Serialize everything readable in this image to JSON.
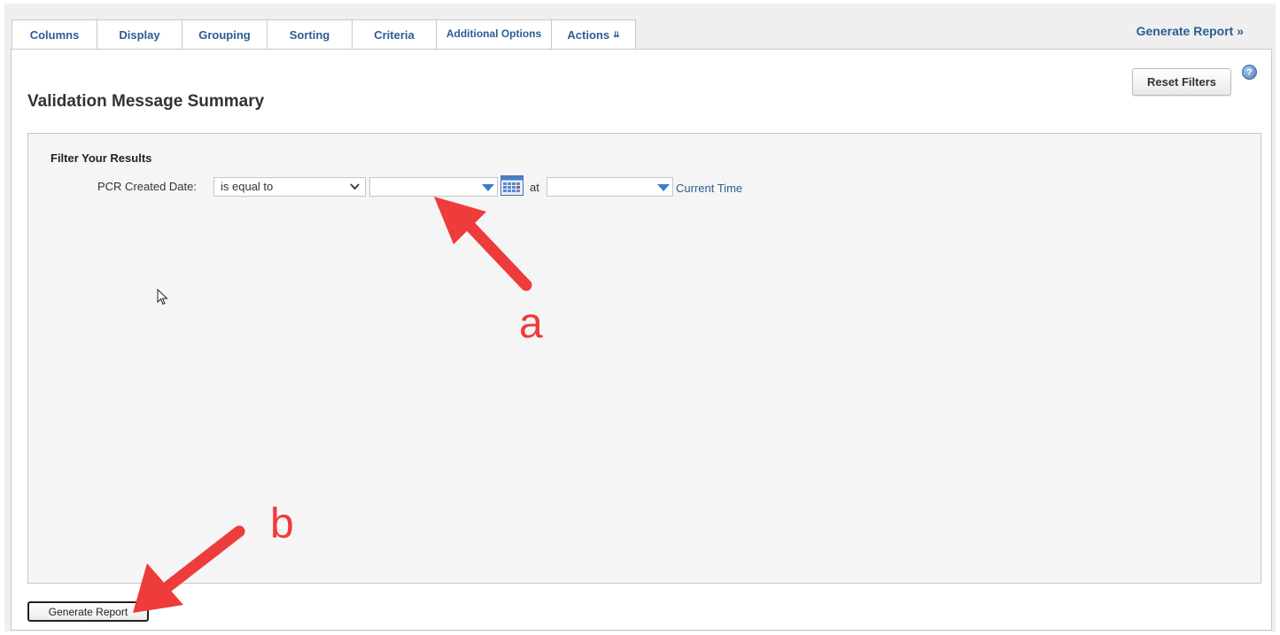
{
  "tabs": [
    {
      "label": "Columns"
    },
    {
      "label": "Display"
    },
    {
      "label": "Grouping"
    },
    {
      "label": "Sorting"
    },
    {
      "label": "Criteria"
    },
    {
      "label": "Additional Options"
    },
    {
      "label": "Actions",
      "suffix": "»"
    }
  ],
  "header": {
    "generate_link": "Generate Report »",
    "help_icon": "question-circle-icon"
  },
  "report": {
    "title": "Validation Message Summary",
    "reset_filters": "Reset Filters"
  },
  "filter": {
    "heading": "Filter Your Results",
    "field_label": "PCR Created Date:",
    "operator_value": "is equal to",
    "date_value": "",
    "at_label": "at",
    "time_value": "",
    "current_time_link": "Current Time",
    "calendar_icon": "calendar-icon"
  },
  "footer": {
    "generate_button": "Generate Report"
  },
  "annotations": {
    "label_a": "a",
    "label_b": "b",
    "arrow_color": "#ee3b3b"
  },
  "colors": {
    "link": "#2b5d94",
    "annotation": "#ee3b3b"
  }
}
